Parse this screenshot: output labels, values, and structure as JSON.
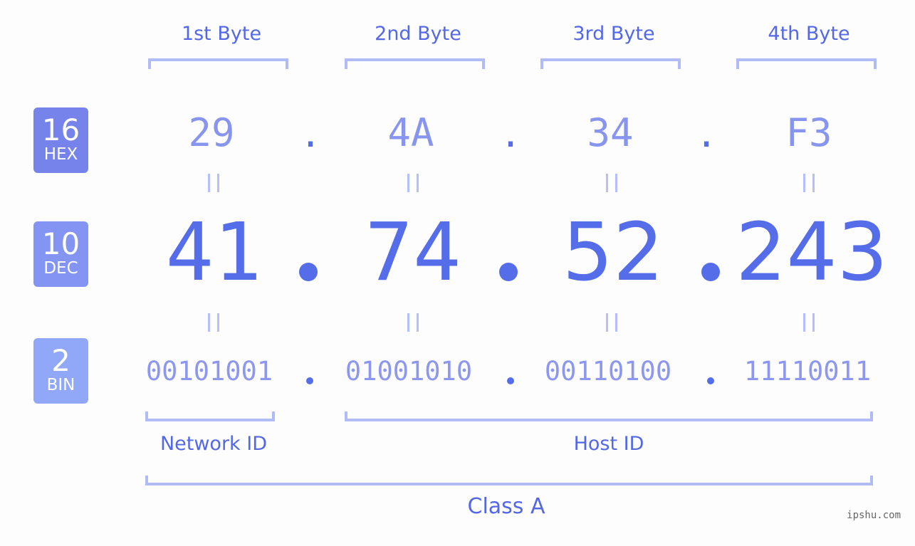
{
  "header": {
    "bytes": [
      "1st Byte",
      "2nd Byte",
      "3rd Byte",
      "4th Byte"
    ]
  },
  "badges": {
    "hex": {
      "num": "16",
      "name": "HEX",
      "color": "#7683eb"
    },
    "dec": {
      "num": "10",
      "name": "DEC",
      "color": "#8494f2"
    },
    "bin": {
      "num": "2",
      "name": "BIN",
      "color": "#91a8f8"
    }
  },
  "ip": {
    "hex": [
      "29",
      "4A",
      "34",
      "F3"
    ],
    "dec": [
      "41",
      "74",
      "52",
      "243"
    ],
    "bin": [
      "00101001",
      "01001010",
      "00110100",
      "11110011"
    ],
    "separator": ".",
    "equals": "="
  },
  "labels": {
    "network_id": "Network ID",
    "host_id": "Host ID",
    "class": "Class A"
  },
  "watermark": "ipshu.com",
  "colors": {
    "accent": "#5468e6",
    "dec_text": "#566de9",
    "hex_text": "#8895ee",
    "bin_text": "#8e97ef",
    "bracket": "#b1bbf6",
    "background": "#fcfdfc"
  }
}
